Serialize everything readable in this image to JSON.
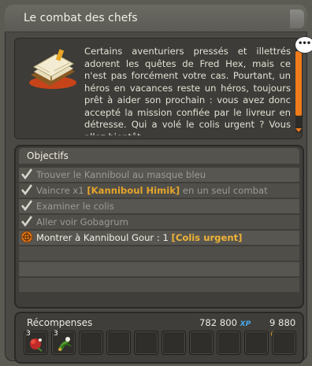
{
  "window": {
    "title": "Le combat des chefs"
  },
  "description": {
    "text": "Certains aventuriers pressés et illettrés adorent les quêtes de Fred Hex, mais ce n'est pas forcément votre cas. Pourtant, un héros en vacances reste un héros, toujours prêt à aider son prochain : vous avez donc accepté la mission confiée par le livreur en détresse. Qui a volé le colis urgent ? Vous allez bientôt",
    "icon": "quest-book-icon"
  },
  "objectives": {
    "header": "Objectifs",
    "items": [
      {
        "status": "done",
        "pre": "Trouver le Kanniboul au masque bleu",
        "hl": "",
        "post": ""
      },
      {
        "status": "done",
        "pre": "Vaincre x1 ",
        "hl": "[Kanniboul Himik]",
        "post": " en un seul combat"
      },
      {
        "status": "done",
        "pre": "Examiner le colis",
        "hl": "",
        "post": ""
      },
      {
        "status": "done",
        "pre": "Aller voir Gobagrum",
        "hl": "",
        "post": ""
      },
      {
        "status": "current",
        "pre": "Montrer à Kanniboul Gour : 1 ",
        "hl": "[Colis urgent]",
        "post": ""
      }
    ]
  },
  "rewards": {
    "label": "Récompenses",
    "xp": "782 800",
    "xp_unit": "XP",
    "kamas": "9 880",
    "items": [
      {
        "qty": "3",
        "icon": "red-flower-item-icon"
      },
      {
        "qty": "3",
        "icon": "green-plant-item-icon"
      }
    ]
  },
  "colors": {
    "accent": "#ef7b1a",
    "highlight": "#f0b437",
    "xp": "#4aa8e8"
  }
}
